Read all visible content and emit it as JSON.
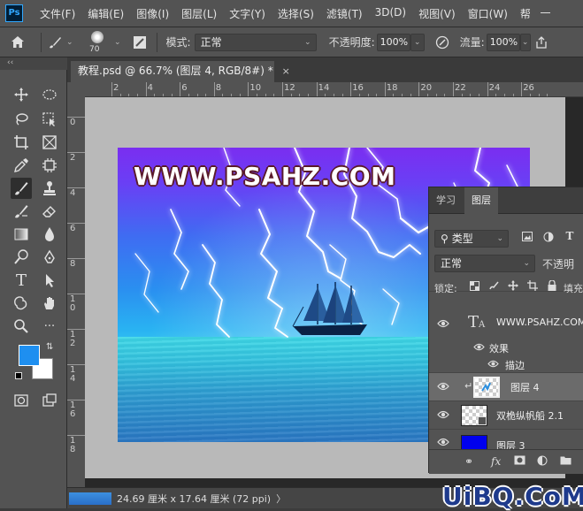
{
  "app": {
    "logo_text": "Ps"
  },
  "menu": [
    "文件(F)",
    "编辑(E)",
    "图像(I)",
    "图层(L)",
    "文字(Y)",
    "选择(S)",
    "滤镜(T)",
    "3D(D)",
    "视图(V)",
    "窗口(W)",
    "帮"
  ],
  "options_bar": {
    "brush_size": "70",
    "mode_label": "模式:",
    "mode_value": "正常",
    "opacity_label": "不透明度:",
    "opacity_value": "100%",
    "flow_label": "流量:",
    "flow_value": "100%"
  },
  "tabs": {
    "collapse": "‹‹",
    "document": "教程.psd @ 66.7% (图层 4, RGB/8#) *",
    "close": "×"
  },
  "ruler": {
    "h_labels": [
      "2",
      "4",
      "6",
      "8",
      "10",
      "12",
      "14",
      "16",
      "18",
      "20",
      "22",
      "24",
      "26"
    ],
    "v_labels": [
      "0",
      "2",
      "4",
      "6",
      "8",
      "1 0",
      "1 2",
      "1 4",
      "1 6",
      "1 8"
    ]
  },
  "artwork": {
    "title": "WWW.PSAHZ.COM"
  },
  "colors": {
    "foreground": "#1e8ff0",
    "background": "#ffffff",
    "accent": "#31a8ff"
  },
  "layers_panel": {
    "tabs": [
      "学习",
      "图层"
    ],
    "filter_label": "类型",
    "blend_mode": "正常",
    "opacity_label": "不透明",
    "lock_label": "锁定:",
    "fill_label": "填充",
    "layers": [
      {
        "name": "WWW.PSAHZ.COM",
        "kind": "text"
      },
      {
        "name": "效果",
        "kind": "effects"
      },
      {
        "name": "描边",
        "kind": "effect"
      },
      {
        "name": "图层 4",
        "kind": "pixel",
        "selected": true
      },
      {
        "name": "双桅纵帆船 2.1",
        "kind": "smart"
      },
      {
        "name": "图层 3",
        "kind": "fill"
      }
    ]
  },
  "status": {
    "text": "24.69 厘米 x 17.64 厘米 (72 ppi)",
    "arrow": "〉"
  },
  "watermark": "UiBQ.CoM"
}
